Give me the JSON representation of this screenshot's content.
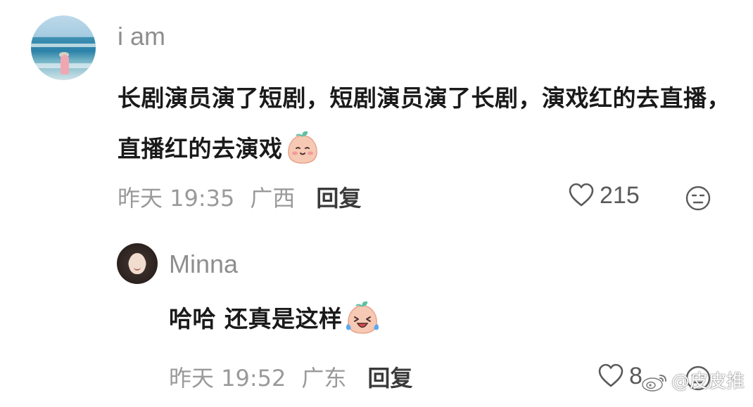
{
  "comments": [
    {
      "username": "i am",
      "text": "长剧演员演了短剧，短剧演员演了长剧，演戏红的去直播，直播红的去演戏",
      "emoji": "peach-smile-emoji",
      "time": "昨天 19:35",
      "location": "广西",
      "reply_label": "回复",
      "likes": "215"
    }
  ],
  "reply": {
    "username": "Minna",
    "text": "哈哈 还真是这样",
    "emoji": "peach-laugh-cry-emoji",
    "time": "昨天 19:52",
    "location": "广东",
    "reply_label": "回复",
    "likes": "8"
  },
  "watermark": {
    "text": "@皮皮推",
    "icon": "weibo-logo-icon"
  },
  "colors": {
    "meta_gray": "#9a9a9a",
    "username_gray": "#8e8e8e",
    "text_dark": "#1a1a1a",
    "emoji_peach": "#f6c9b4",
    "emoji_leaf": "#5cc0a4"
  }
}
